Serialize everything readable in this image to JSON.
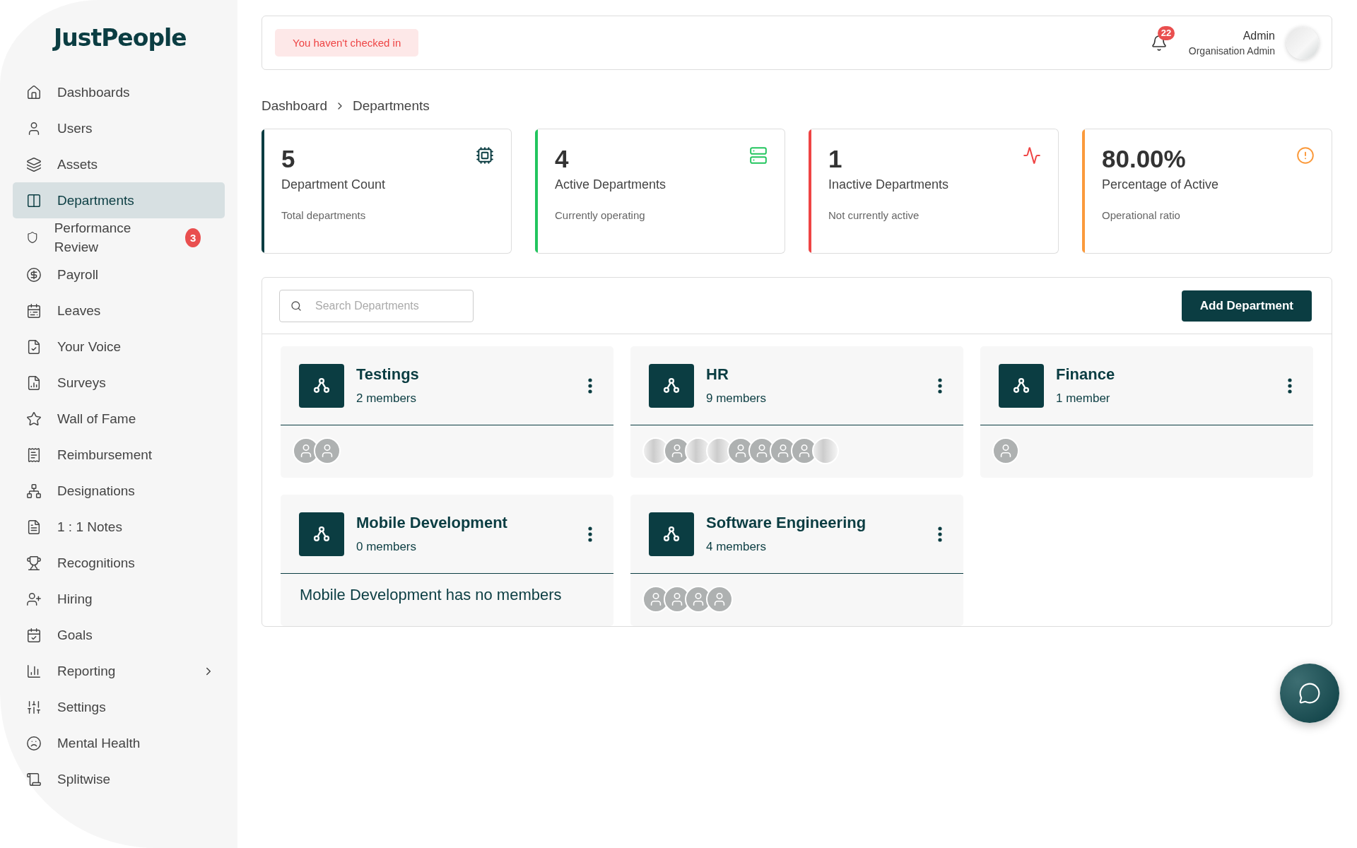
{
  "sidebar": {
    "logo": "JustPeople",
    "items": [
      {
        "label": "Dashboards",
        "selected": false,
        "expandable": false
      },
      {
        "label": "Users",
        "selected": false,
        "expandable": false
      },
      {
        "label": "Assets",
        "selected": false,
        "expandable": false
      },
      {
        "label": "Departments",
        "selected": true,
        "expandable": false
      },
      {
        "label": "Performance Review",
        "selected": false,
        "expandable": false,
        "badge": "3"
      },
      {
        "label": "Payroll",
        "selected": false,
        "expandable": false
      },
      {
        "label": "Leaves",
        "selected": false,
        "expandable": false
      },
      {
        "label": "Your Voice",
        "selected": false,
        "expandable": false
      },
      {
        "label": "Surveys",
        "selected": false,
        "expandable": false
      },
      {
        "label": "Wall of Fame",
        "selected": false,
        "expandable": false
      },
      {
        "label": "Reimbursement",
        "selected": false,
        "expandable": false
      },
      {
        "label": "Designations",
        "selected": false,
        "expandable": false
      },
      {
        "label": "1 : 1 Notes",
        "selected": false,
        "expandable": false
      },
      {
        "label": "Recognitions",
        "selected": false,
        "expandable": false
      },
      {
        "label": "Hiring",
        "selected": false,
        "expandable": false
      },
      {
        "label": "Goals",
        "selected": false,
        "expandable": false
      },
      {
        "label": "Reporting",
        "selected": false,
        "expandable": true
      },
      {
        "label": "Settings",
        "selected": false,
        "expandable": false
      },
      {
        "label": "Mental Health",
        "selected": false,
        "expandable": false
      },
      {
        "label": "Splitwise",
        "selected": false,
        "expandable": false
      }
    ]
  },
  "top_bar": {
    "check_in_notice": "You haven't checked in",
    "notification_count": "22",
    "user_name": "Admin",
    "user_role": "Organisation Admin"
  },
  "breadcrumb": [
    "Dashboard",
    "Departments"
  ],
  "stats": [
    {
      "value": "5",
      "label": "Department Count",
      "caption": "Total departments",
      "color": "#0b3d42"
    },
    {
      "value": "4",
      "label": "Active Departments",
      "caption": "Currently operating",
      "color": "#22c55e"
    },
    {
      "value": "1",
      "label": "Inactive Departments",
      "caption": "Not currently active",
      "color": "#ef4444"
    },
    {
      "value": "80.00%",
      "label": "Percentage of Active",
      "caption": "Operational ratio",
      "color": "#fb9a3c"
    }
  ],
  "search": {
    "placeholder": "Search Departments"
  },
  "add_button": "Add Department",
  "departments": [
    {
      "name": "Testings",
      "members": "2 members",
      "avatars": [
        {
          "kind": "silhouette"
        },
        {
          "kind": "silhouette"
        }
      ]
    },
    {
      "name": "HR",
      "members": "9 members",
      "avatars": [
        {
          "kind": "photo"
        },
        {
          "kind": "silhouette"
        },
        {
          "kind": "photo"
        },
        {
          "kind": "photo"
        },
        {
          "kind": "silhouette"
        },
        {
          "kind": "silhouette"
        },
        {
          "kind": "silhouette"
        },
        {
          "kind": "silhouette"
        },
        {
          "kind": "photo"
        }
      ]
    },
    {
      "name": "Finance",
      "members": "1 member",
      "avatars": [
        {
          "kind": "silhouette"
        }
      ]
    },
    {
      "name": "Mobile Development",
      "members": "0 members",
      "empty_text": "Mobile Development has no members"
    },
    {
      "name": "Software Engineering",
      "members": "4 members",
      "avatars": [
        {
          "kind": "silhouette"
        },
        {
          "kind": "silhouette"
        },
        {
          "kind": "silhouette"
        },
        {
          "kind": "silhouette"
        }
      ]
    }
  ]
}
